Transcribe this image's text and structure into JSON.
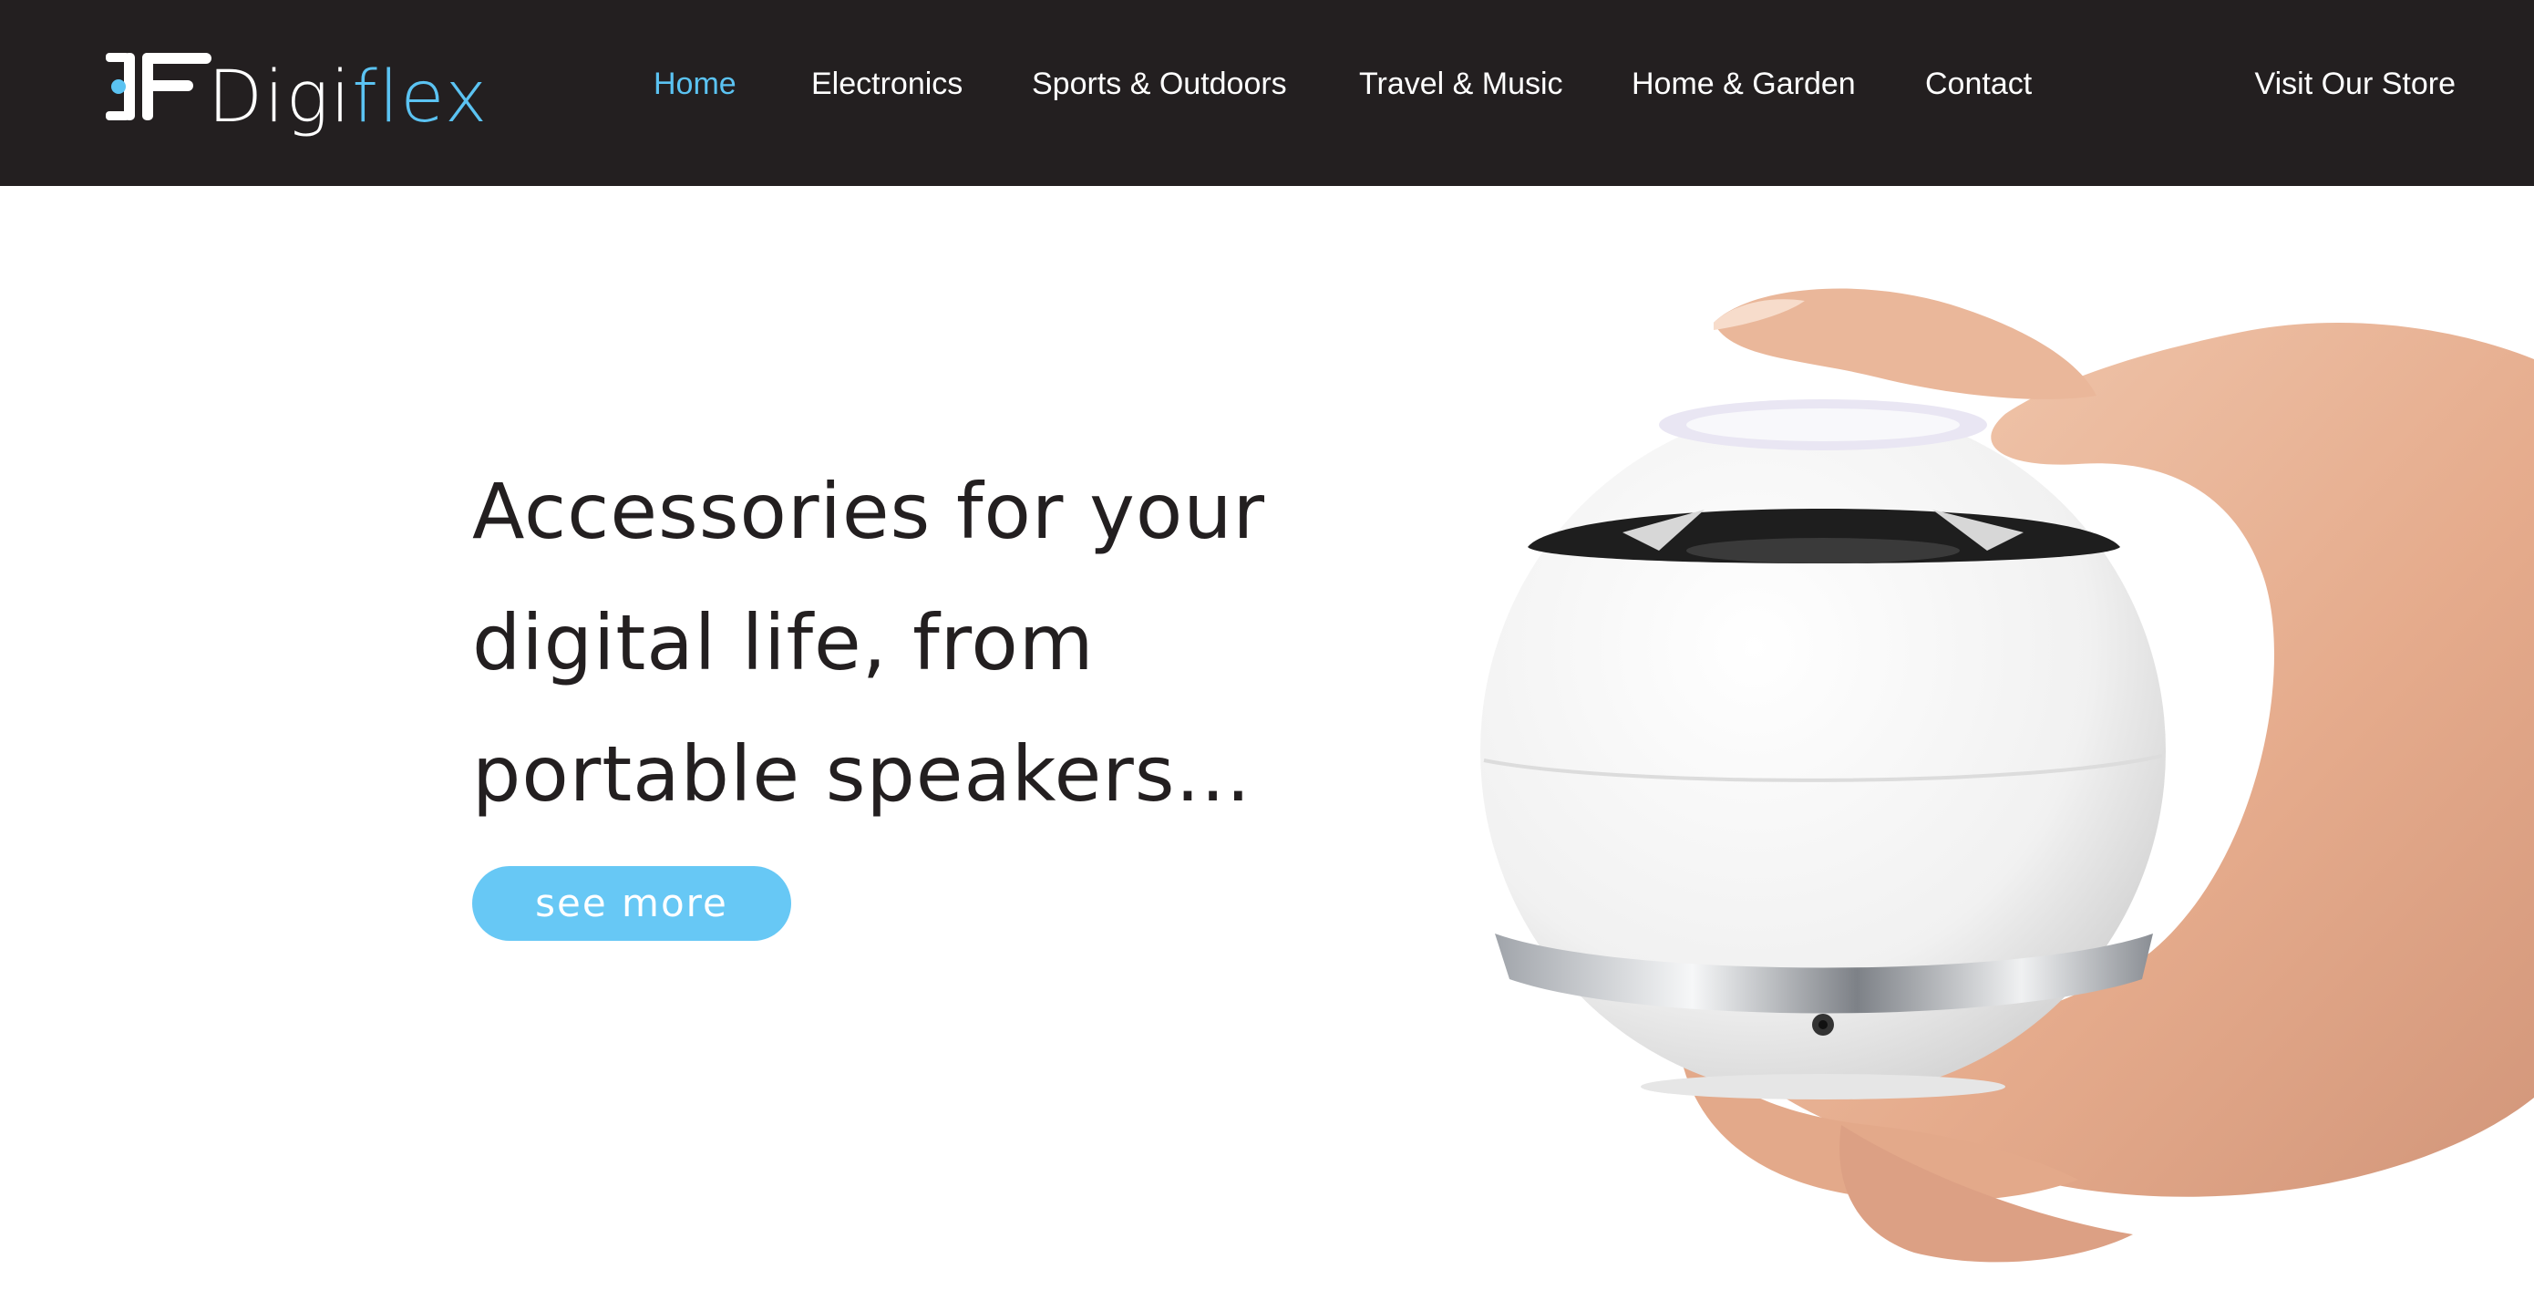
{
  "brand": {
    "prefix": "Digi",
    "suffix": "flex"
  },
  "nav": {
    "items": [
      {
        "label": "Home",
        "active": true
      },
      {
        "label": "Electronics",
        "active": false
      },
      {
        "label": "Sports & Outdoors",
        "active": false
      },
      {
        "label": "Travel & Music",
        "active": false
      },
      {
        "label": "Home & Garden",
        "active": false
      },
      {
        "label": "Contact",
        "active": false
      }
    ],
    "store_link": "Visit Our Store"
  },
  "hero": {
    "headline_lines": [
      "Accessories for your",
      "digital life, from",
      "portable speakers..."
    ],
    "cta_label": "see more",
    "image": "hand-holding-white-spherical-speaker"
  },
  "colors": {
    "topbar": "#231f20",
    "accent": "#5bc3f2",
    "button": "#67c8f5",
    "text_dark": "#231f20"
  }
}
